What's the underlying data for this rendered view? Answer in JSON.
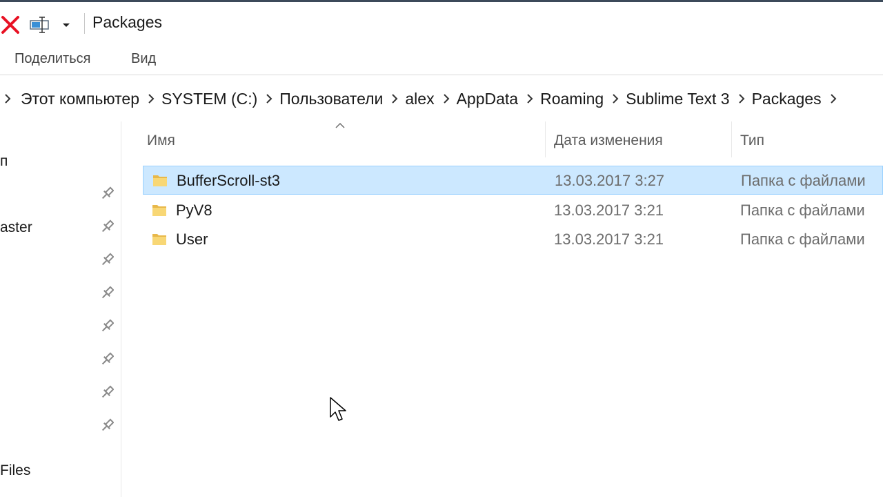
{
  "window": {
    "title": "Packages"
  },
  "quick_access_toolbar": {
    "delete_icon": "red-x-icon",
    "rename_icon": "rename-icon",
    "dropdown_icon": "chevron-down-icon"
  },
  "ribbon": {
    "tabs": [
      {
        "label": "Поделиться"
      },
      {
        "label": "Вид"
      }
    ]
  },
  "address_bar": {
    "crumbs": [
      {
        "label": "Этот компьютер"
      },
      {
        "label": "SYSTEM (C:)"
      },
      {
        "label": "Пользователи"
      },
      {
        "label": "alex"
      },
      {
        "label": "AppData"
      },
      {
        "label": "Roaming"
      },
      {
        "label": "Sublime Text 3"
      },
      {
        "label": "Packages"
      }
    ]
  },
  "nav_pane": {
    "items": [
      {
        "label": "п"
      },
      {
        "label": "aster"
      },
      {
        "label": "Files"
      }
    ],
    "pin_icon": "pin-icon"
  },
  "file_list": {
    "columns": {
      "name": "Имя",
      "date": "Дата изменения",
      "type": "Тип"
    },
    "sorted_by": "name",
    "rows": [
      {
        "name": "BufferScroll-st3",
        "date": "13.03.2017 3:27",
        "type": "Папка с файлами",
        "selected": true
      },
      {
        "name": "PyV8",
        "date": "13.03.2017 3:21",
        "type": "Папка с файлами",
        "selected": false
      },
      {
        "name": "User",
        "date": "13.03.2017 3:21",
        "type": "Папка с файлами",
        "selected": false
      }
    ]
  },
  "colors": {
    "selection_bg": "#cce8ff",
    "selection_border": "#99d1ff",
    "folder_yellow": "#f8d775",
    "delete_red": "#e81123"
  }
}
